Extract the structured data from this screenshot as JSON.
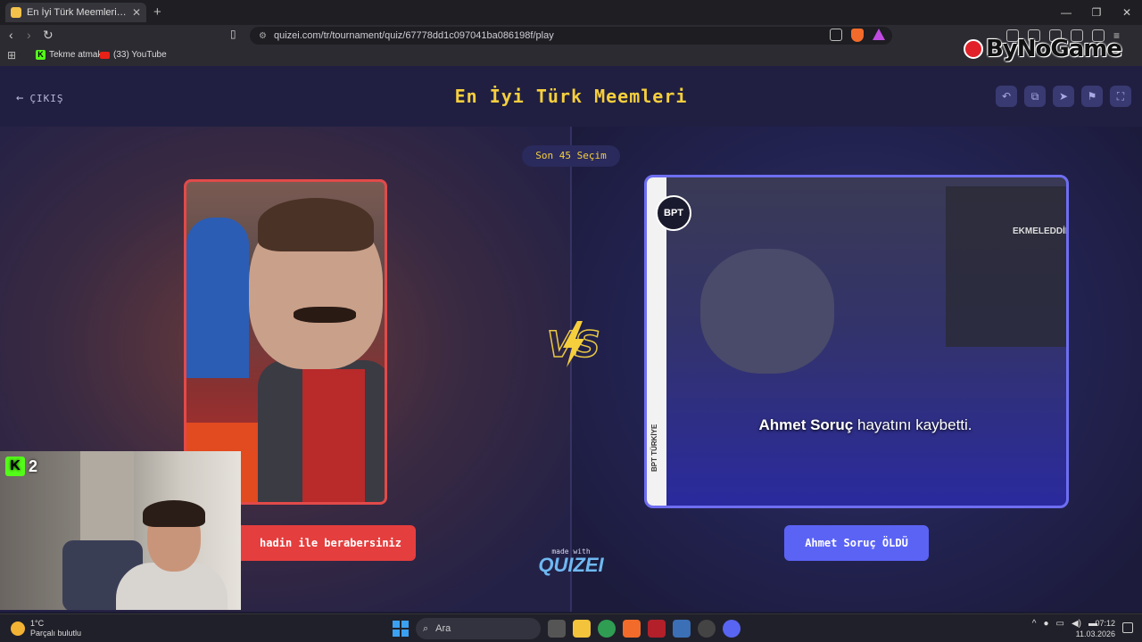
{
  "browser": {
    "tab_title": "En İyi Türk Meemleri - Tier List, K",
    "url": "quizei.com/tr/tournament/quiz/67778dd1c097041ba086198f/play",
    "bookmarks": [
      {
        "label": "Tekme atmak",
        "icon": "kick-icon"
      },
      {
        "label": "(33) YouTube",
        "icon": "youtube-icon"
      }
    ]
  },
  "overlay": {
    "logo_text": "ByNoGame",
    "kick_count": "2"
  },
  "header": {
    "exit_label": "ÇIKIŞ",
    "title": "En İyi Türk Meemleri",
    "buttons": [
      "undo-icon",
      "share-icon",
      "send-icon",
      "flag-icon",
      "fullscreen-icon"
    ]
  },
  "match": {
    "counter": "Son 45 Seçim",
    "left": {
      "label": "hadin ile berabersiniz",
      "accent": "#e53e3e"
    },
    "right": {
      "label": "Ahmet Soruç ÖLDÜ",
      "accent": "#5b63f5",
      "caption_name": "Ahmet Soruç",
      "caption_rest": " hayatını kaybetti.",
      "badge": "BPT",
      "strip": "BPT TÜRKİYE",
      "screen_title": "EKMELEDDİN"
    },
    "vs": "VS"
  },
  "footer": {
    "made_with": "made with",
    "brand": "QUIZEI"
  },
  "taskbar": {
    "temp": "1°C",
    "weather": "Parçalı bulutlu",
    "search": "Ara",
    "time": "07:12",
    "date": "11.03.2026"
  }
}
